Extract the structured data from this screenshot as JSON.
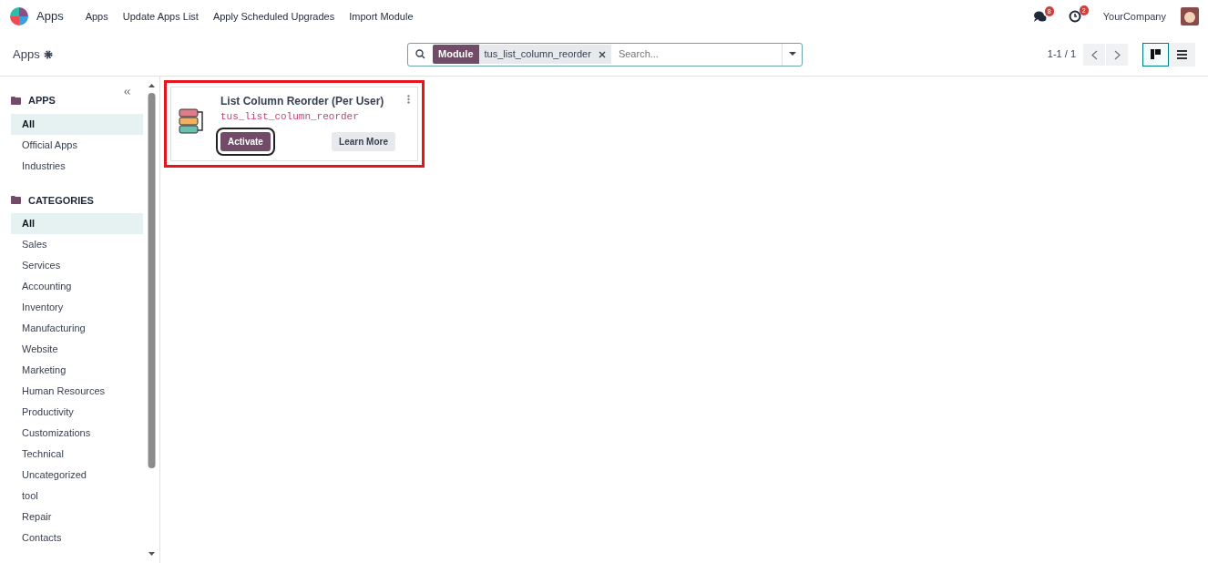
{
  "navbar": {
    "app_name": "Apps",
    "menu": [
      "Apps",
      "Update Apps List",
      "Apply Scheduled Upgrades",
      "Import Module"
    ],
    "messages_count": "8",
    "activities_count": "2",
    "company": "YourCompany"
  },
  "control_panel": {
    "breadcrumb": "Apps",
    "search": {
      "facet_label": "Module",
      "facet_value": "tus_list_column_reorder",
      "placeholder": "Search..."
    },
    "pager": "1-1 / 1",
    "views": [
      {
        "kind": "kanban",
        "selected": true
      },
      {
        "kind": "list",
        "selected": false
      }
    ]
  },
  "sidebar": {
    "sections": [
      {
        "title": "APPS",
        "items": [
          {
            "label": "All",
            "selected": true
          },
          {
            "label": "Official Apps",
            "selected": false
          },
          {
            "label": "Industries",
            "selected": false
          }
        ]
      },
      {
        "title": "CATEGORIES",
        "items": [
          {
            "label": "All",
            "selected": true
          },
          {
            "label": "Sales",
            "selected": false
          },
          {
            "label": "Services",
            "selected": false
          },
          {
            "label": "Accounting",
            "selected": false
          },
          {
            "label": "Inventory",
            "selected": false
          },
          {
            "label": "Manufacturing",
            "selected": false
          },
          {
            "label": "Website",
            "selected": false
          },
          {
            "label": "Marketing",
            "selected": false
          },
          {
            "label": "Human Resources",
            "selected": false
          },
          {
            "label": "Productivity",
            "selected": false
          },
          {
            "label": "Customizations",
            "selected": false
          },
          {
            "label": "Technical",
            "selected": false
          },
          {
            "label": "Uncategorized",
            "selected": false
          },
          {
            "label": "tool",
            "selected": false
          },
          {
            "label": "Repair",
            "selected": false
          },
          {
            "label": "Contacts",
            "selected": false
          }
        ]
      }
    ]
  },
  "modules": [
    {
      "name": "List Column Reorder (Per User)",
      "technical_name": "tus_list_column_reorder",
      "highlighted": true,
      "buttons": [
        {
          "kind": "primary",
          "label": "Activate",
          "outlined": true
        },
        {
          "kind": "secondary",
          "label": "Learn More",
          "outlined": false
        }
      ]
    }
  ]
}
